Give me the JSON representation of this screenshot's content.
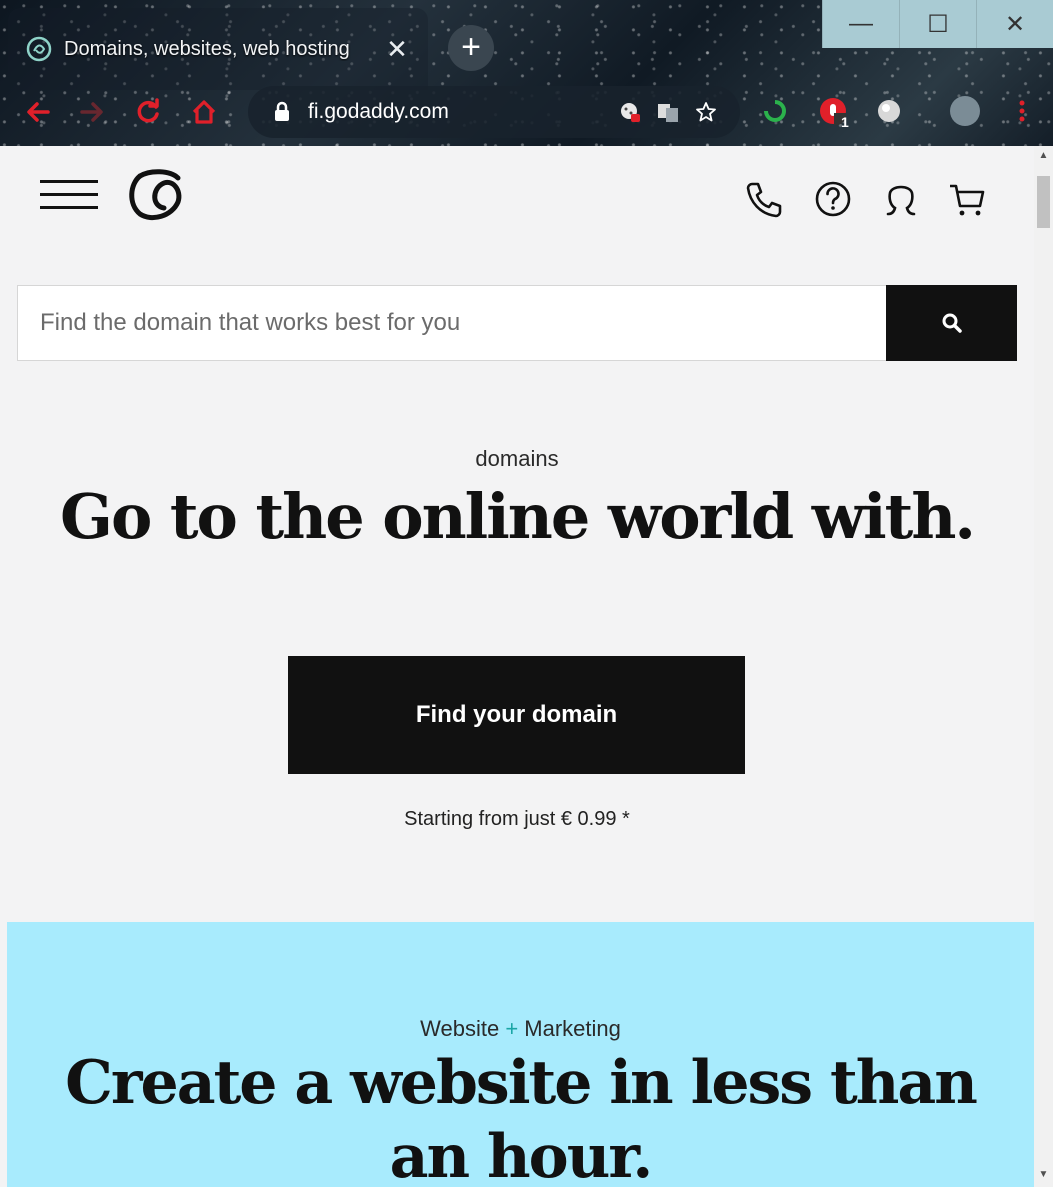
{
  "browser": {
    "tab_title": "Domains, websites, web hosting",
    "tab_close": "✕",
    "new_tab": "+",
    "url": "fi.godaddy.com",
    "window_minimize": "—",
    "window_maximize": "☐",
    "window_close": "✕",
    "extension_badge": "1"
  },
  "header": {
    "icons": [
      "menu-icon",
      "godaddy-logo",
      "phone-icon",
      "help-icon",
      "account-icon",
      "cart-icon"
    ]
  },
  "search": {
    "placeholder": "Find the domain that works best for you"
  },
  "hero": {
    "eyebrow": "domains",
    "title": "Go to the online world with.",
    "cta_label": "Find your domain",
    "price_note": "Starting from just € 0.99 *"
  },
  "promo": {
    "eyebrow_left": "Website",
    "eyebrow_plus": "+",
    "eyebrow_right": "Marketing",
    "title": "Create a website in less than an hour."
  },
  "colors": {
    "promo_bg": "#a8ebfd",
    "button_bg": "#111111",
    "page_bg": "#f3f3f4",
    "plus_accent": "#1aa5a5"
  }
}
